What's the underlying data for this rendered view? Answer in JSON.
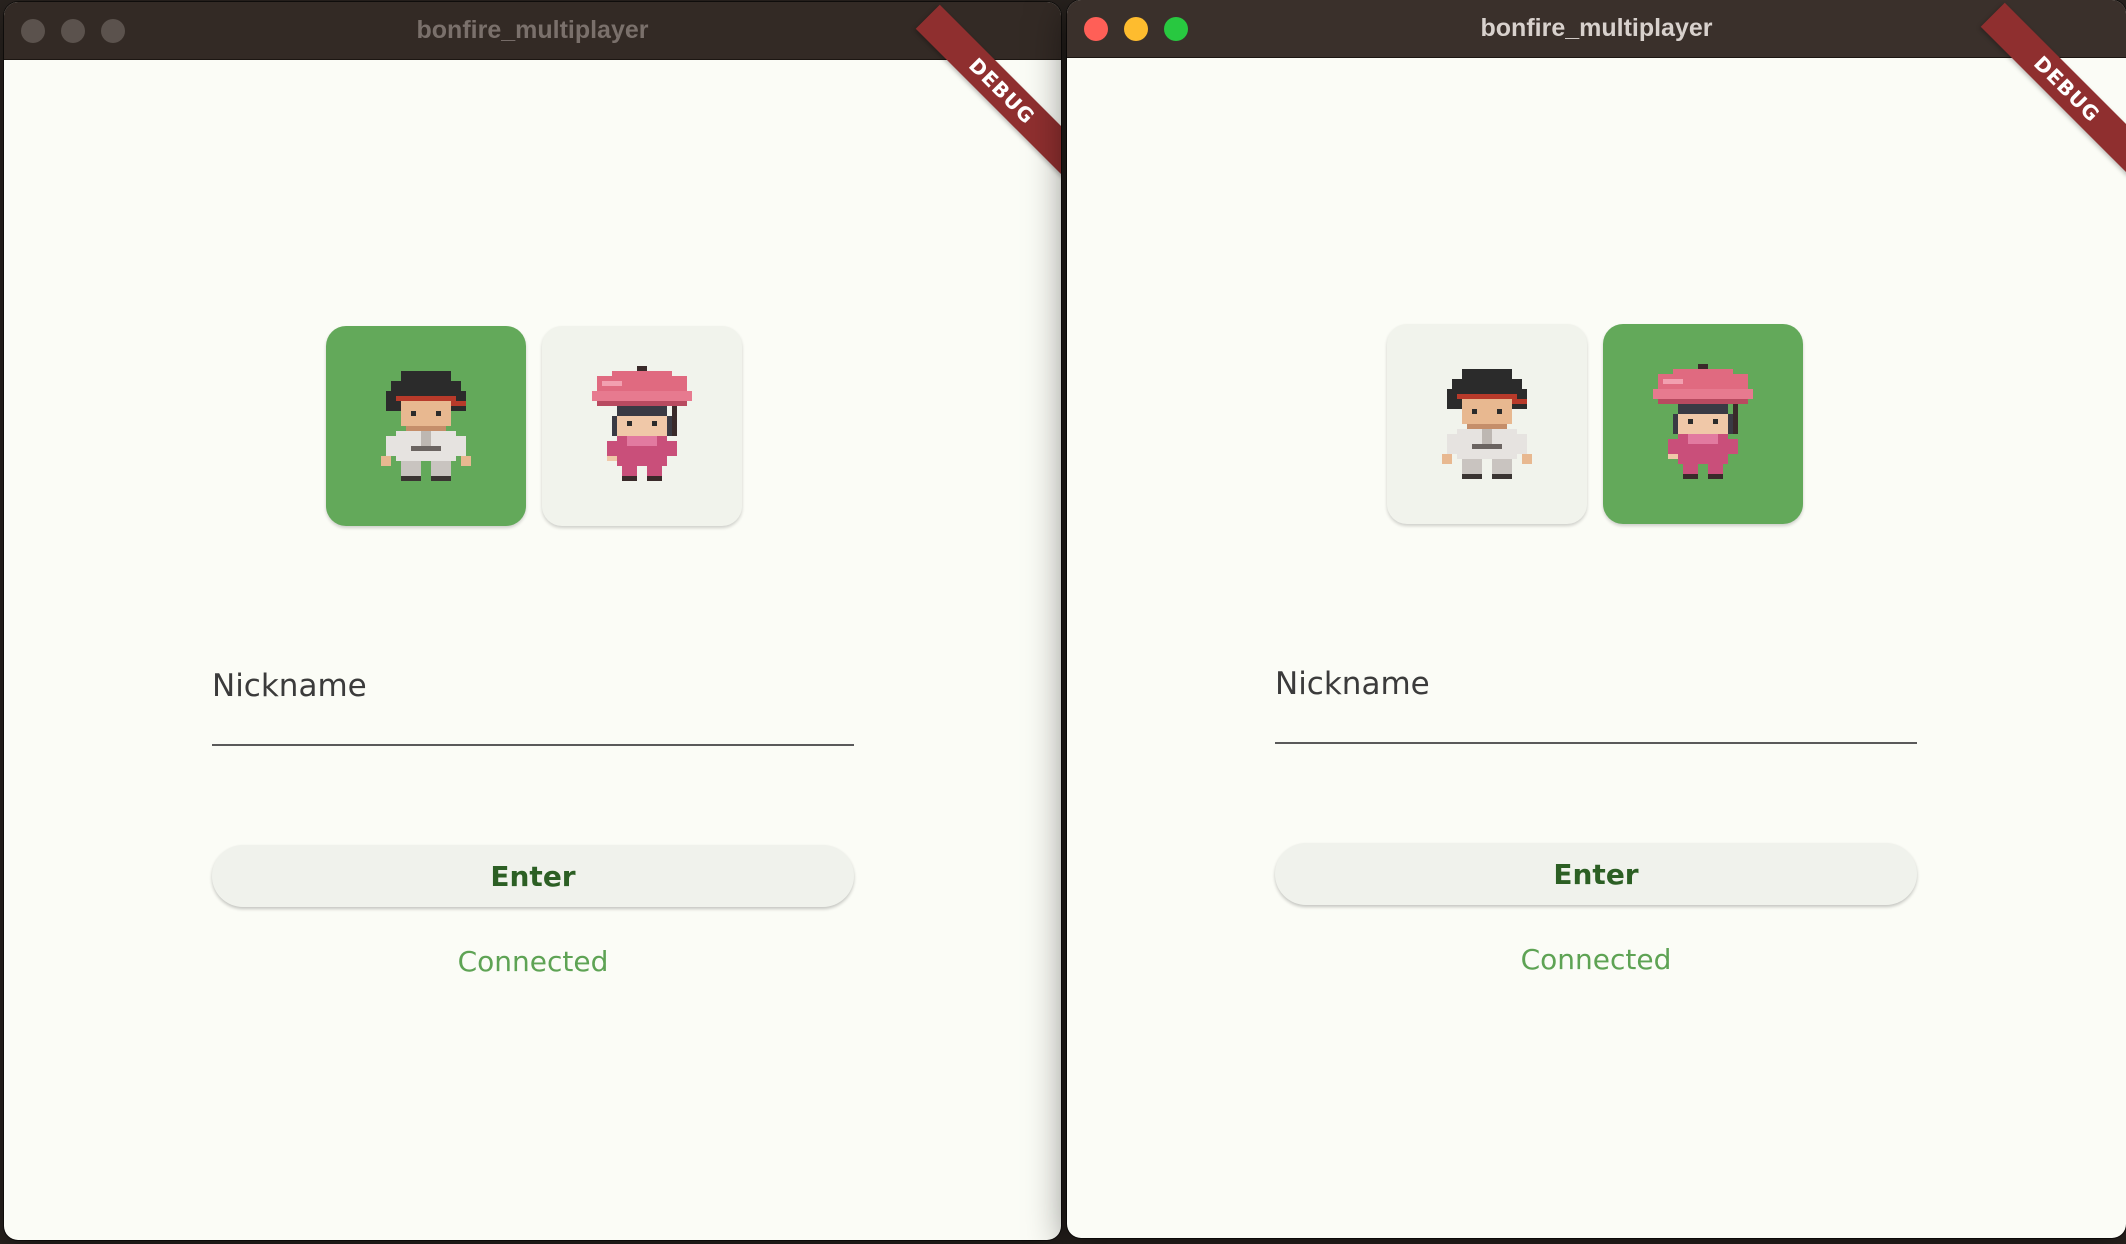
{
  "windows": [
    {
      "id": "left",
      "title": "bonfire_multiplayer",
      "focused": false,
      "debug_banner": "DEBUG",
      "characters": [
        {
          "name": "boy-sprite-icon",
          "selected": true
        },
        {
          "name": "girl-umbrella-sprite-icon",
          "selected": false
        }
      ],
      "nickname": {
        "label": "Nickname",
        "value": ""
      },
      "enter_label": "Enter",
      "status": "Connected"
    },
    {
      "id": "right",
      "title": "bonfire_multiplayer",
      "focused": true,
      "debug_banner": "DEBUG",
      "characters": [
        {
          "name": "boy-sprite-icon",
          "selected": false
        },
        {
          "name": "girl-umbrella-sprite-icon",
          "selected": true
        }
      ],
      "nickname": {
        "label": "Nickname",
        "value": ""
      },
      "enter_label": "Enter",
      "status": "Connected"
    }
  ],
  "colors": {
    "selected_card": "#63a95a",
    "unselected_card": "#f1f3ec",
    "enter_text": "#2c5f24",
    "status_text": "#5ea354",
    "debug_ribbon": "#8f2f2f",
    "window_bg": "#fbfcf6"
  }
}
